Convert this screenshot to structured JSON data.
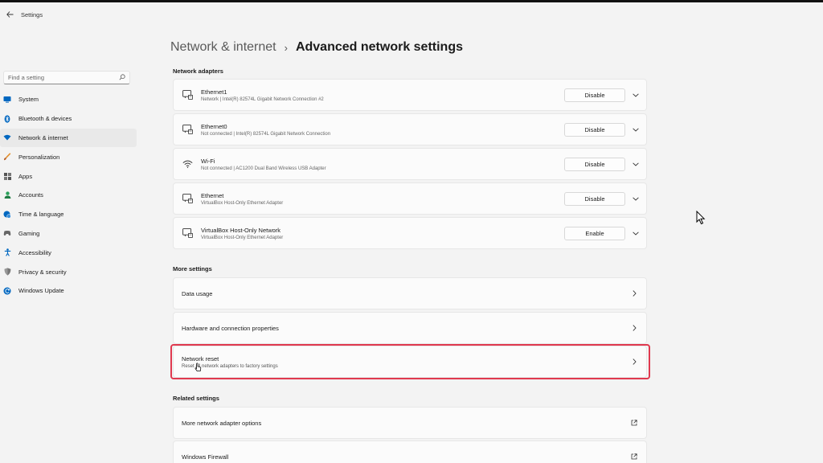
{
  "app": {
    "title": "Settings"
  },
  "search": {
    "placeholder": "Find a setting"
  },
  "sidebar": {
    "items": [
      {
        "label": "System",
        "icon": "monitor-icon",
        "color": "#0067c0"
      },
      {
        "label": "Bluetooth & devices",
        "icon": "bluetooth-icon",
        "color": "#0067c0"
      },
      {
        "label": "Network & internet",
        "icon": "wifi-diamond-icon",
        "color": "#0067c0",
        "active": true
      },
      {
        "label": "Personalization",
        "icon": "brush-icon",
        "color": "#e3902e"
      },
      {
        "label": "Apps",
        "icon": "apps-icon",
        "color": "#555555"
      },
      {
        "label": "Accounts",
        "icon": "person-icon",
        "color": "#2aa05a"
      },
      {
        "label": "Time & language",
        "icon": "globe-clock-icon",
        "color": "#0067c0"
      },
      {
        "label": "Gaming",
        "icon": "gamepad-icon",
        "color": "#555555"
      },
      {
        "label": "Accessibility",
        "icon": "accessibility-icon",
        "color": "#0067c0"
      },
      {
        "label": "Privacy & security",
        "icon": "shield-icon",
        "color": "#666666"
      },
      {
        "label": "Windows Update",
        "icon": "update-icon",
        "color": "#0067c0"
      }
    ]
  },
  "breadcrumb": {
    "parent": "Network & internet",
    "separator": "›",
    "current": "Advanced network settings"
  },
  "sections": {
    "adapters_title": "Network adapters",
    "more_title": "More settings",
    "related_title": "Related settings"
  },
  "adapters": [
    {
      "name": "Ethernet1",
      "desc": "Network | Intel(R) 82574L Gigabit Network Connection #2",
      "button": "Disable",
      "icon": "ethernet-icon"
    },
    {
      "name": "Ethernet0",
      "desc": "Not connected | Intel(R) 82574L Gigabit Network Connection",
      "button": "Disable",
      "icon": "ethernet-icon"
    },
    {
      "name": "Wi-Fi",
      "desc": "Not connected | AC1200  Dual Band Wireless USB Adapter",
      "button": "Disable",
      "icon": "wifi-icon"
    },
    {
      "name": "Ethernet",
      "desc": "VirtualBox Host-Only Ethernet Adapter",
      "button": "Disable",
      "icon": "ethernet-icon"
    },
    {
      "name": "VirtualBox Host-Only Network",
      "desc": "VirtualBox Host-Only Ethernet Adapter",
      "button": "Enable",
      "icon": "ethernet-icon"
    }
  ],
  "more_settings": [
    {
      "title": "Data usage",
      "desc": ""
    },
    {
      "title": "Hardware and connection properties",
      "desc": ""
    },
    {
      "title": "Network reset",
      "desc": "Reset all network adapters to factory settings"
    }
  ],
  "related_settings": [
    {
      "title": "More network adapter options",
      "icon": "external-link-icon"
    },
    {
      "title": "Windows Firewall",
      "icon": "external-link-icon"
    }
  ],
  "colors": {
    "highlight": "#e0394f",
    "accent": "#0067c0"
  }
}
